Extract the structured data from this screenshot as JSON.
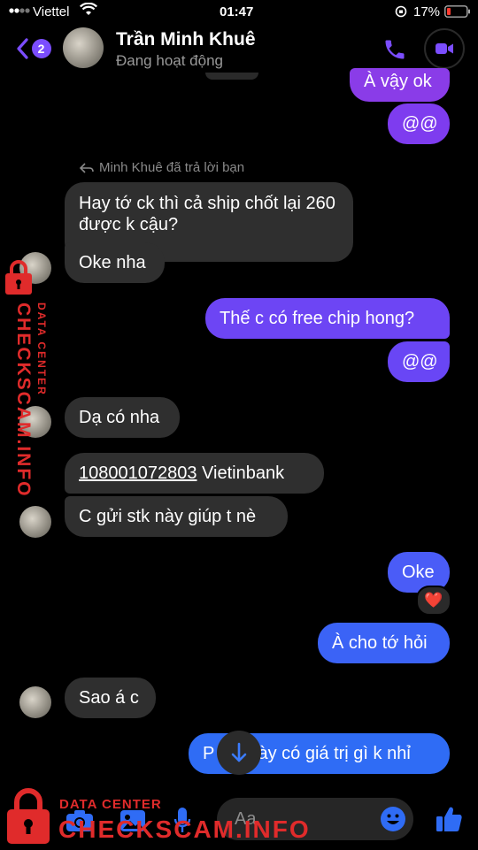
{
  "status_bar": {
    "carrier": "Viettel",
    "time": "01:47",
    "battery": "17%"
  },
  "header": {
    "back_count": "2",
    "contact_name": "Trần Minh Khuê",
    "presence": "Đang hoạt động"
  },
  "messages": {
    "m1": "À vậy ok",
    "m2": "@@",
    "reply_note": "Minh Khuê đã trả lời bạn",
    "m3_line1": "Hay tớ ck thì cả ship chốt lại 260",
    "m3_line2": "được k cậu?",
    "m4": "Oke nha",
    "m5": "Thế c có free chip hong?",
    "m6": "@@",
    "m7": "Dạ có nha",
    "m8_number": "108001072803",
    "m8_bank": " Vietinbank",
    "m9": "C gửi stk này giúp t nè",
    "m10": "Oke",
    "m10_reaction": "❤️",
    "m11": "À cho tớ hỏi",
    "m12": "Sao á c",
    "m13_prefix": "P",
    "m13_rest": "này có giá trị gì k nhỉ"
  },
  "composer": {
    "placeholder": "Aa"
  },
  "watermark": {
    "side_top": "DATA CENTER",
    "side_main": "CHECKSCAM.INFO",
    "bottom_top": "DATA CENTER",
    "bottom_main": "CHECKSCAM.INFO"
  },
  "colors": {
    "accent": "#7b4dff",
    "bubble_purple": "#7a3cf0",
    "bubble_blue": "#2f6cf5",
    "incoming": "#2f2f2f",
    "watermark": "#e02b2b"
  }
}
